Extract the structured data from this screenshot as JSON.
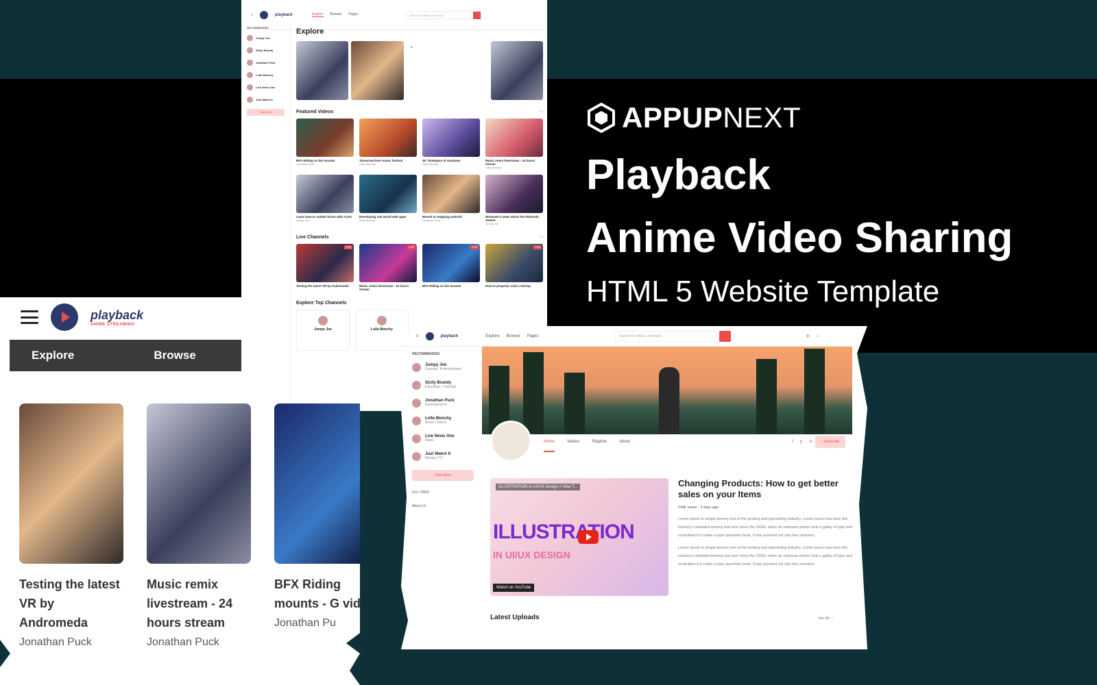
{
  "colors": {
    "accent": "#e94c4c",
    "background": "#0e3138",
    "band": "#000000"
  },
  "promo": {
    "brand_bold": "APPUP",
    "brand_light": "NEXT",
    "title_line1": "Playback",
    "title_line2": "Anime Video Sharing",
    "title_line3": "HTML 5 Website Template"
  },
  "screen_a": {
    "logo": "playback",
    "nav": [
      "Explore",
      "Browse",
      "Pages"
    ],
    "search_placeholder": "Search for videos, channels...",
    "sidebar_heading": "RECOMMENDED",
    "sidebar_items": [
      "Jumpy Joe",
      "Sicily Brandy",
      "Jonathan Puck",
      "Lolla Monchy",
      "Live News One",
      "Just Watch It"
    ],
    "view_more": "View More",
    "explore_title": "Explore",
    "featured_title": "Featured Videos",
    "featured": [
      {
        "title": "BFX Riding on the mounts",
        "author": "Jonathan Puck"
      },
      {
        "title": "Tomorrow best music festival",
        "author": "Lolla Monchy"
      },
      {
        "title": "4K Timelapse of sundown",
        "author": "Sicily Brandy"
      },
      {
        "title": "Music remix livestream - 24 hours stream",
        "author": "Lolla Monchy"
      },
      {
        "title": "Learn how to submit forms with AJAX",
        "author": "Jumpy Joe"
      },
      {
        "title": "Developing real world web apps",
        "author": "Sicily Brandy"
      },
      {
        "title": "Moved to mapping android",
        "author": "Jonathan Puck"
      },
      {
        "title": "Nintendo's news about the Nintendo Switch",
        "author": "Jumpy Joe"
      }
    ],
    "live_title": "Live Channels",
    "live": [
      {
        "title": "Testing the latest VR by Andromeda"
      },
      {
        "title": "Music remix livestream - 24 hours stream"
      },
      {
        "title": "BFX Riding on the mounts"
      },
      {
        "title": "How to properly cook a shrimp"
      }
    ],
    "live_badge": "LIVE",
    "channels_title": "Explore Top Channels",
    "channels": [
      "Jumpy Joe",
      "Lolla Monchy"
    ]
  },
  "screen_b": {
    "logo": "playback",
    "logo_sub": "ANIME STREAMING",
    "nav": [
      "Explore",
      "Browse"
    ],
    "cards": [
      {
        "title": "Testing the latest VR by Andromeda",
        "author": "Jonathan Puck"
      },
      {
        "title": "Music remix livestream - 24 hours stream",
        "author": "Jonathan Puck"
      },
      {
        "title": "BFX Riding mounts - G video",
        "author": "Jonathan Pu"
      }
    ]
  },
  "screen_c": {
    "logo": "playback",
    "nav": [
      "Explore",
      "Browse",
      "Pages"
    ],
    "search_placeholder": "Search for videos, channels...",
    "sidebar_heading": "RECOMMENDED",
    "sidebar_items": [
      {
        "name": "Jumpy Joe",
        "cat": "Gaming / Entertainment"
      },
      {
        "name": "Sicily Brandy",
        "cat": "Education / Tutorials"
      },
      {
        "name": "Jonathan Puck",
        "cat": "Entertainment"
      },
      {
        "name": "Lolla Monchy",
        "cat": "Music / Dance"
      },
      {
        "name": "Live News One",
        "cat": "News"
      },
      {
        "name": "Just Watch It",
        "cat": "Movies / TV"
      }
    ],
    "view_more": "View More",
    "links": [
      "FUL LINKS",
      "About Us"
    ],
    "tabs": [
      "Home",
      "Videos",
      "Playlists",
      "About"
    ],
    "social": [
      "f",
      "p",
      "in"
    ],
    "subscribe": "+ Subscribe",
    "video_title_bar": "ILLUSTRATION in UI/UX Design // How T...",
    "video_big": "ILLUSTRATION",
    "video_sub": "IN UI/UX DESIGN",
    "watch_on": "Watch on YouTube",
    "info_title": "Changing Products: How to get better sales on your Items",
    "info_meta": "244k views · 2 days ago",
    "info_p1": "Lorem Ipsum is simply dummy text of the printing and typesetting industry. Lorem Ipsum has been the industry's standard dummy text ever since the 1500s, when an unknown printer took a galley of type and scrambled it to make a type specimen book. It has survived not only five centuries",
    "info_p2": "Lorem Ipsum is simply dummy text of the printing and typesetting industry. Lorem Ipsum has been the industry's standard dummy text ever since the 1500s, when an unknown printer took a galley of type and scrambled it to make a type specimen book. It has survived not only five centuries",
    "latest": "Latest Uploads",
    "see_all": "See All"
  }
}
